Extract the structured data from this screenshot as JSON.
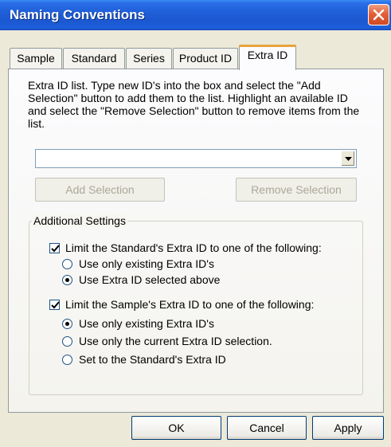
{
  "window": {
    "title": "Naming Conventions"
  },
  "tabs": [
    {
      "label": "Sample",
      "active": false
    },
    {
      "label": "Standard",
      "active": false
    },
    {
      "label": "Series",
      "active": false
    },
    {
      "label": "Product ID",
      "active": false
    },
    {
      "label": "Extra ID",
      "active": true
    }
  ],
  "panel": {
    "description": "Extra ID list. Type new ID's into the box and select the \"Add Selection\" button to add them to the list. Highlight an available ID and select the \"Remove Selection\" button to remove items from the list.",
    "combo_value": "",
    "add_selection_label": "Add Selection",
    "remove_selection_label": "Remove Selection"
  },
  "additional_settings": {
    "legend": "Additional Settings",
    "standard_check_label": "Limit the Standard's Extra ID to one of the following:",
    "standard_check_checked": true,
    "standard_options": [
      {
        "label": "Use only existing Extra ID's",
        "selected": false
      },
      {
        "label": "Use Extra ID selected above",
        "selected": true
      }
    ],
    "sample_check_label": "Limit the Sample's Extra ID to one of the following:",
    "sample_check_checked": true,
    "sample_options": [
      {
        "label": "Use only existing Extra ID's",
        "selected": true
      },
      {
        "label": "Use only the current Extra ID selection.",
        "selected": false
      },
      {
        "label": "Set to the Standard's Extra ID",
        "selected": false
      }
    ]
  },
  "footer": {
    "ok_label": "OK",
    "cancel_label": "Cancel",
    "apply_label": "Apply"
  },
  "icons": {
    "close": "close-icon",
    "dropdown": "chevron-down-icon",
    "check": "check-icon"
  }
}
